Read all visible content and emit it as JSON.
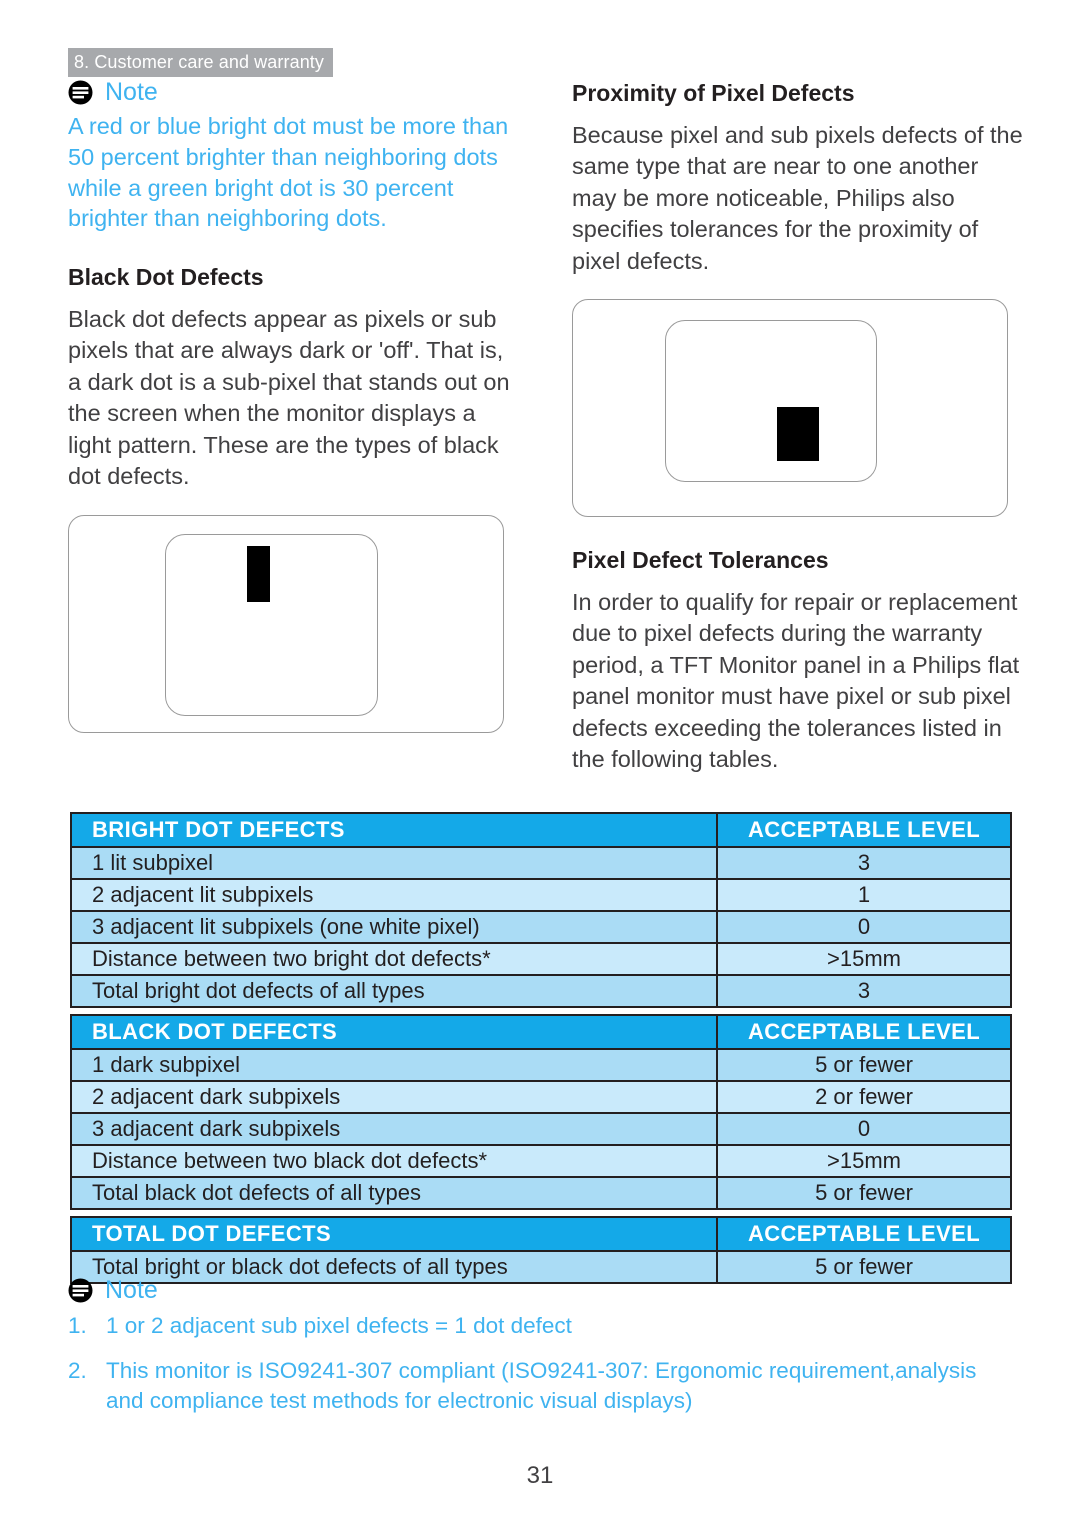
{
  "header": {
    "running_title": "8. Customer care and warranty"
  },
  "colors": {
    "accent_blue": "#3fb3f0",
    "table_header_blue": "#14a9e8",
    "table_row_blue": "#aadcf5",
    "table_row_blue_alt": "#c9eafb",
    "running_head_gray": "#a7a9ac",
    "defect_black": "#000000"
  },
  "left_column": {
    "note": {
      "icon": "note-icon",
      "label": "Note",
      "text": "A red or blue bright dot must be more than 50 percent brighter than neighboring dots while a green bright dot is 30 percent brighter than neighboring dots."
    },
    "black_dot_defects": {
      "heading": "Black Dot Defects",
      "paragraph": "Black dot defects appear as pixels or sub pixels that are always dark or 'off'. That is, a dark dot is a sub-pixel that stands out on the screen when the monitor displays a light pattern. These are the types of black dot defects."
    },
    "figure": {
      "name": "black-dot-defect-diagram",
      "description": "Monitor outline with inner screen containing one tall black subpixel defect"
    }
  },
  "right_column": {
    "proximity": {
      "heading": "Proximity of Pixel Defects",
      "paragraph": "Because pixel and sub pixels defects of the same type that are near to one another may be more noticeable, Philips also specifies tolerances for the proximity of pixel defects."
    },
    "figure": {
      "name": "proximity-defect-diagram",
      "description": "Monitor outline with inner screen containing one black pixel defect block"
    },
    "tolerances": {
      "heading": "Pixel Defect Tolerances",
      "paragraph": "In order to qualify for repair or replacement due to pixel defects during the warranty period, a TFT Monitor panel in a Philips flat panel monitor must have pixel or sub pixel defects exceeding the tolerances listed in the following tables."
    }
  },
  "tables": [
    {
      "id": "bright-dot-defects",
      "headers": [
        "BRIGHT DOT DEFECTS",
        "ACCEPTABLE LEVEL"
      ],
      "rows": [
        [
          "1 lit subpixel",
          "3"
        ],
        [
          "2 adjacent lit subpixels",
          "1"
        ],
        [
          "3 adjacent lit subpixels (one white pixel)",
          "0"
        ],
        [
          "Distance between two bright dot defects*",
          ">15mm"
        ],
        [
          "Total bright dot defects of all types",
          "3"
        ]
      ]
    },
    {
      "id": "black-dot-defects",
      "headers": [
        "BLACK DOT DEFECTS",
        "ACCEPTABLE LEVEL"
      ],
      "rows": [
        [
          "1 dark subpixel",
          "5 or fewer"
        ],
        [
          "2 adjacent dark subpixels",
          "2 or fewer"
        ],
        [
          "3 adjacent dark subpixels",
          "0"
        ],
        [
          "Distance between two black dot defects*",
          ">15mm"
        ],
        [
          "Total black dot defects of all types",
          "5 or fewer"
        ]
      ]
    },
    {
      "id": "total-dot-defects",
      "headers": [
        "TOTAL DOT DEFECTS",
        "ACCEPTABLE LEVEL"
      ],
      "rows": [
        [
          "Total bright or black dot defects of all types",
          "5 or fewer"
        ]
      ]
    }
  ],
  "bottom_note": {
    "icon": "note-icon",
    "label": "Note",
    "items": [
      {
        "num": "1.",
        "text": "1 or 2 adjacent sub pixel defects = 1 dot defect"
      },
      {
        "num": "2.",
        "text": "This monitor is ISO9241-307 compliant (ISO9241-307: Ergonomic requirement,analysis and compliance test methods for electronic visual displays)"
      }
    ]
  },
  "folio": {
    "page_number": "31"
  }
}
